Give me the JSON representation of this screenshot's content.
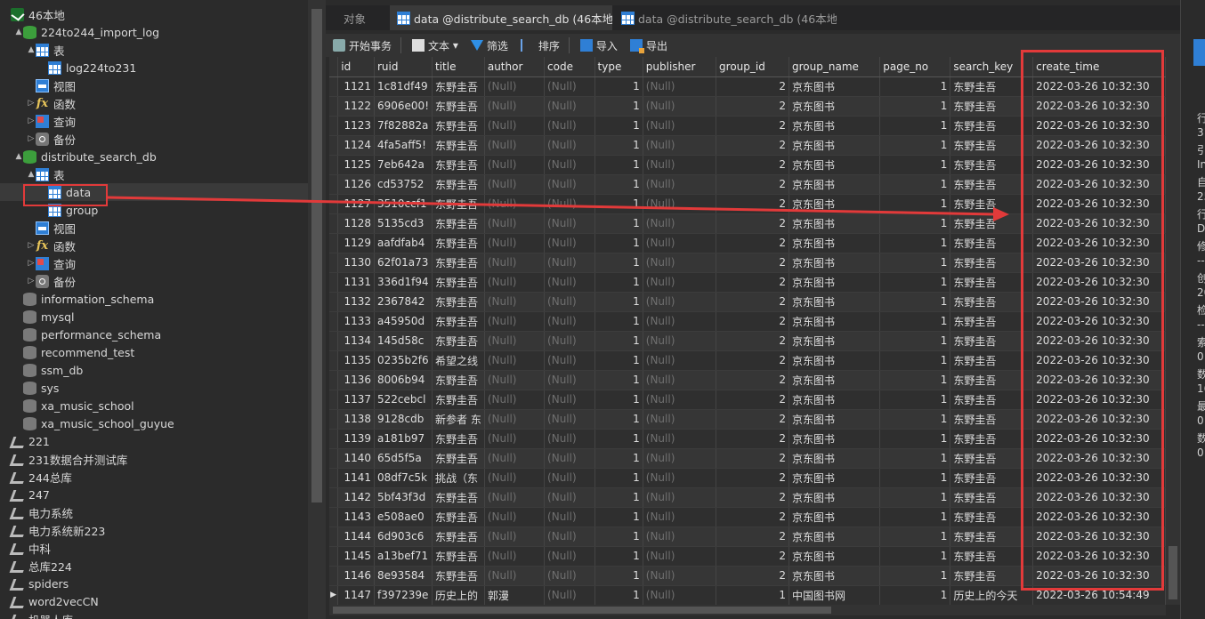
{
  "colors": {
    "annotation": "#e23a3a",
    "accent": "#2f7fd5",
    "null_text": "#6f6f6f"
  },
  "sidebar": {
    "items": [
      {
        "label": "46本地",
        "icon": "connection-icon",
        "level": 0,
        "expand": ""
      },
      {
        "label": "224to244_import_log",
        "icon": "database-icon",
        "level": 1,
        "expand": "▲"
      },
      {
        "label": "表",
        "icon": "table-icon",
        "level": 2,
        "expand": "▲"
      },
      {
        "label": "log224to231",
        "icon": "table-icon",
        "level": 3,
        "expand": ""
      },
      {
        "label": "视图",
        "icon": "view-icon",
        "level": 2,
        "expand": ""
      },
      {
        "label": "函数",
        "icon": "function-icon",
        "level": 2,
        "expand": "▷"
      },
      {
        "label": "查询",
        "icon": "query-icon",
        "level": 2,
        "expand": "▷"
      },
      {
        "label": "备份",
        "icon": "backup-icon",
        "level": 2,
        "expand": "▷"
      },
      {
        "label": "distribute_search_db",
        "icon": "database-icon",
        "level": 1,
        "expand": "▲"
      },
      {
        "label": "表",
        "icon": "table-icon",
        "level": 2,
        "expand": "▲"
      },
      {
        "label": "data",
        "icon": "table-icon",
        "level": 3,
        "expand": ""
      },
      {
        "label": "group",
        "icon": "table-icon",
        "level": 3,
        "expand": ""
      },
      {
        "label": "视图",
        "icon": "view-icon",
        "level": 2,
        "expand": ""
      },
      {
        "label": "函数",
        "icon": "function-icon",
        "level": 2,
        "expand": "▷"
      },
      {
        "label": "查询",
        "icon": "query-icon",
        "level": 2,
        "expand": "▷"
      },
      {
        "label": "备份",
        "icon": "backup-icon",
        "level": 2,
        "expand": "▷"
      },
      {
        "label": "information_schema",
        "icon": "database-off-icon",
        "level": 1,
        "expand": ""
      },
      {
        "label": "mysql",
        "icon": "database-off-icon",
        "level": 1,
        "expand": ""
      },
      {
        "label": "performance_schema",
        "icon": "database-off-icon",
        "level": 1,
        "expand": ""
      },
      {
        "label": "recommend_test",
        "icon": "database-off-icon",
        "level": 1,
        "expand": ""
      },
      {
        "label": "ssm_db",
        "icon": "database-off-icon",
        "level": 1,
        "expand": ""
      },
      {
        "label": "sys",
        "icon": "database-off-icon",
        "level": 1,
        "expand": ""
      },
      {
        "label": "xa_music_school",
        "icon": "database-off-icon",
        "level": 1,
        "expand": ""
      },
      {
        "label": "xa_music_school_guyue",
        "icon": "database-off-icon",
        "level": 1,
        "expand": ""
      },
      {
        "label": "221",
        "icon": "connection-off-icon",
        "level": 0,
        "expand": ""
      },
      {
        "label": "231数据合并测试库",
        "icon": "connection-off-icon",
        "level": 0,
        "expand": ""
      },
      {
        "label": "244总库",
        "icon": "connection-off-icon",
        "level": 0,
        "expand": ""
      },
      {
        "label": "247",
        "icon": "connection-off-icon",
        "level": 0,
        "expand": ""
      },
      {
        "label": "电力系统",
        "icon": "connection-off-icon",
        "level": 0,
        "expand": ""
      },
      {
        "label": "电力系统新223",
        "icon": "connection-off-icon",
        "level": 0,
        "expand": ""
      },
      {
        "label": "中科",
        "icon": "connection-off-icon",
        "level": 0,
        "expand": ""
      },
      {
        "label": "总库224",
        "icon": "connection-off-icon",
        "level": 0,
        "expand": ""
      },
      {
        "label": "spiders",
        "icon": "connection-off-icon",
        "level": 0,
        "expand": ""
      },
      {
        "label": "word2vecCN",
        "icon": "connection-off-icon",
        "level": 0,
        "expand": ""
      },
      {
        "label": "机器人库",
        "icon": "connection-off-icon",
        "level": 0,
        "expand": ""
      }
    ]
  },
  "tabs": [
    {
      "label": "对象",
      "active": false
    },
    {
      "label": "data @distribute_search_db (46本地)...",
      "active": true
    },
    {
      "label": "data @distribute_search_db (46本地)...",
      "active": false
    }
  ],
  "toolbar": {
    "begin_tx": "开始事务",
    "text": "文本",
    "text_dropdown": "▾",
    "filter": "筛选",
    "sort": "排序",
    "import": "导入",
    "export": "导出"
  },
  "grid": {
    "columns": [
      "id",
      "ruid",
      "title",
      "author",
      "code",
      "type",
      "publisher",
      "group_id",
      "group_name",
      "page_no",
      "search_key",
      "create_time"
    ],
    "null_text": "(Null)",
    "current_row_marker": "▶",
    "rows": [
      {
        "id": "1121",
        "ruid": "1c81df49",
        "title": "东野圭吾",
        "type": "1",
        "group_id": "2",
        "group_name": "京东图书",
        "page_no": "1",
        "search_key": "东野圭吾",
        "create_time": "2022-03-26 10:32:30"
      },
      {
        "id": "1122",
        "ruid": "6906e00!",
        "title": "东野圭吾",
        "type": "1",
        "group_id": "2",
        "group_name": "京东图书",
        "page_no": "1",
        "search_key": "东野圭吾",
        "create_time": "2022-03-26 10:32:30"
      },
      {
        "id": "1123",
        "ruid": "7f82882a",
        "title": "东野圭吾",
        "type": "1",
        "group_id": "2",
        "group_name": "京东图书",
        "page_no": "1",
        "search_key": "东野圭吾",
        "create_time": "2022-03-26 10:32:30"
      },
      {
        "id": "1124",
        "ruid": "4fa5aff5!",
        "title": "东野圭吾",
        "type": "1",
        "group_id": "2",
        "group_name": "京东图书",
        "page_no": "1",
        "search_key": "东野圭吾",
        "create_time": "2022-03-26 10:32:30"
      },
      {
        "id": "1125",
        "ruid": "7eb642a",
        "title": "东野圭吾",
        "type": "1",
        "group_id": "2",
        "group_name": "京东图书",
        "page_no": "1",
        "search_key": "东野圭吾",
        "create_time": "2022-03-26 10:32:30"
      },
      {
        "id": "1126",
        "ruid": "cd53752",
        "title": "东野圭吾",
        "type": "1",
        "group_id": "2",
        "group_name": "京东图书",
        "page_no": "1",
        "search_key": "东野圭吾",
        "create_time": "2022-03-26 10:32:30"
      },
      {
        "id": "1127",
        "ruid": "3510ccf1",
        "title": "东野圭吾",
        "type": "1",
        "group_id": "2",
        "group_name": "京东图书",
        "page_no": "1",
        "search_key": "东野圭吾",
        "create_time": "2022-03-26 10:32:30"
      },
      {
        "id": "1128",
        "ruid": "5135cd3",
        "title": "东野圭吾",
        "type": "1",
        "group_id": "2",
        "group_name": "京东图书",
        "page_no": "1",
        "search_key": "东野圭吾",
        "create_time": "2022-03-26 10:32:30"
      },
      {
        "id": "1129",
        "ruid": "aafdfab4",
        "title": "东野圭吾",
        "type": "1",
        "group_id": "2",
        "group_name": "京东图书",
        "page_no": "1",
        "search_key": "东野圭吾",
        "create_time": "2022-03-26 10:32:30"
      },
      {
        "id": "1130",
        "ruid": "62f01a73",
        "title": "东野圭吾",
        "type": "1",
        "group_id": "2",
        "group_name": "京东图书",
        "page_no": "1",
        "search_key": "东野圭吾",
        "create_time": "2022-03-26 10:32:30"
      },
      {
        "id": "1131",
        "ruid": "336d1f94",
        "title": "东野圭吾",
        "type": "1",
        "group_id": "2",
        "group_name": "京东图书",
        "page_no": "1",
        "search_key": "东野圭吾",
        "create_time": "2022-03-26 10:32:30"
      },
      {
        "id": "1132",
        "ruid": "2367842",
        "title": "东野圭吾",
        "type": "1",
        "group_id": "2",
        "group_name": "京东图书",
        "page_no": "1",
        "search_key": "东野圭吾",
        "create_time": "2022-03-26 10:32:30"
      },
      {
        "id": "1133",
        "ruid": "a45950d",
        "title": "东野圭吾",
        "type": "1",
        "group_id": "2",
        "group_name": "京东图书",
        "page_no": "1",
        "search_key": "东野圭吾",
        "create_time": "2022-03-26 10:32:30"
      },
      {
        "id": "1134",
        "ruid": "145d58c",
        "title": "东野圭吾",
        "type": "1",
        "group_id": "2",
        "group_name": "京东图书",
        "page_no": "1",
        "search_key": "东野圭吾",
        "create_time": "2022-03-26 10:32:30"
      },
      {
        "id": "1135",
        "ruid": "0235b2f6",
        "title": "希望之线",
        "type": "1",
        "group_id": "2",
        "group_name": "京东图书",
        "page_no": "1",
        "search_key": "东野圭吾",
        "create_time": "2022-03-26 10:32:30"
      },
      {
        "id": "1136",
        "ruid": "8006b94",
        "title": "东野圭吾",
        "type": "1",
        "group_id": "2",
        "group_name": "京东图书",
        "page_no": "1",
        "search_key": "东野圭吾",
        "create_time": "2022-03-26 10:32:30"
      },
      {
        "id": "1137",
        "ruid": "522cebcl",
        "title": "东野圭吾",
        "type": "1",
        "group_id": "2",
        "group_name": "京东图书",
        "page_no": "1",
        "search_key": "东野圭吾",
        "create_time": "2022-03-26 10:32:30"
      },
      {
        "id": "1138",
        "ruid": "9128cdb",
        "title": "新参者 东",
        "type": "1",
        "group_id": "2",
        "group_name": "京东图书",
        "page_no": "1",
        "search_key": "东野圭吾",
        "create_time": "2022-03-26 10:32:30"
      },
      {
        "id": "1139",
        "ruid": "a181b97",
        "title": "东野圭吾",
        "type": "1",
        "group_id": "2",
        "group_name": "京东图书",
        "page_no": "1",
        "search_key": "东野圭吾",
        "create_time": "2022-03-26 10:32:30"
      },
      {
        "id": "1140",
        "ruid": "65d5f5a",
        "title": "东野圭吾",
        "type": "1",
        "group_id": "2",
        "group_name": "京东图书",
        "page_no": "1",
        "search_key": "东野圭吾",
        "create_time": "2022-03-26 10:32:30"
      },
      {
        "id": "1141",
        "ruid": "08df7c5k",
        "title": "挑战（东",
        "type": "1",
        "group_id": "2",
        "group_name": "京东图书",
        "page_no": "1",
        "search_key": "东野圭吾",
        "create_time": "2022-03-26 10:32:30"
      },
      {
        "id": "1142",
        "ruid": "5bf43f3d",
        "title": "东野圭吾",
        "type": "1",
        "group_id": "2",
        "group_name": "京东图书",
        "page_no": "1",
        "search_key": "东野圭吾",
        "create_time": "2022-03-26 10:32:30"
      },
      {
        "id": "1143",
        "ruid": "e508ae0",
        "title": "东野圭吾",
        "type": "1",
        "group_id": "2",
        "group_name": "京东图书",
        "page_no": "1",
        "search_key": "东野圭吾",
        "create_time": "2022-03-26 10:32:30"
      },
      {
        "id": "1144",
        "ruid": "6d903c6",
        "title": "东野圭吾",
        "type": "1",
        "group_id": "2",
        "group_name": "京东图书",
        "page_no": "1",
        "search_key": "东野圭吾",
        "create_time": "2022-03-26 10:32:30"
      },
      {
        "id": "1145",
        "ruid": "a13bef71",
        "title": "东野圭吾",
        "type": "1",
        "group_id": "2",
        "group_name": "京东图书",
        "page_no": "1",
        "search_key": "东野圭吾",
        "create_time": "2022-03-26 10:32:30"
      },
      {
        "id": "1146",
        "ruid": "8e93584",
        "title": "东野圭吾",
        "type": "1",
        "group_id": "2",
        "group_name": "京东图书",
        "page_no": "1",
        "search_key": "东野圭吾",
        "create_time": "2022-03-26 10:32:30"
      },
      {
        "id": "1147",
        "ruid": "f397239e",
        "title": "历史上的",
        "author": "郭漫",
        "type": "1",
        "group_id": "1",
        "group_name": "中国图书网",
        "page_no": "1",
        "search_key": "历史上的今天",
        "create_time": "2022-03-26 10:54:49"
      }
    ]
  },
  "info_panel": {
    "labels": [
      "行",
      "31",
      "引",
      "In",
      "自",
      "25",
      "行",
      "Dy",
      "修",
      "--",
      "创",
      "20",
      "检",
      "--",
      "索",
      "0",
      "数",
      "16",
      "最",
      "0",
      "数",
      "0"
    ]
  }
}
